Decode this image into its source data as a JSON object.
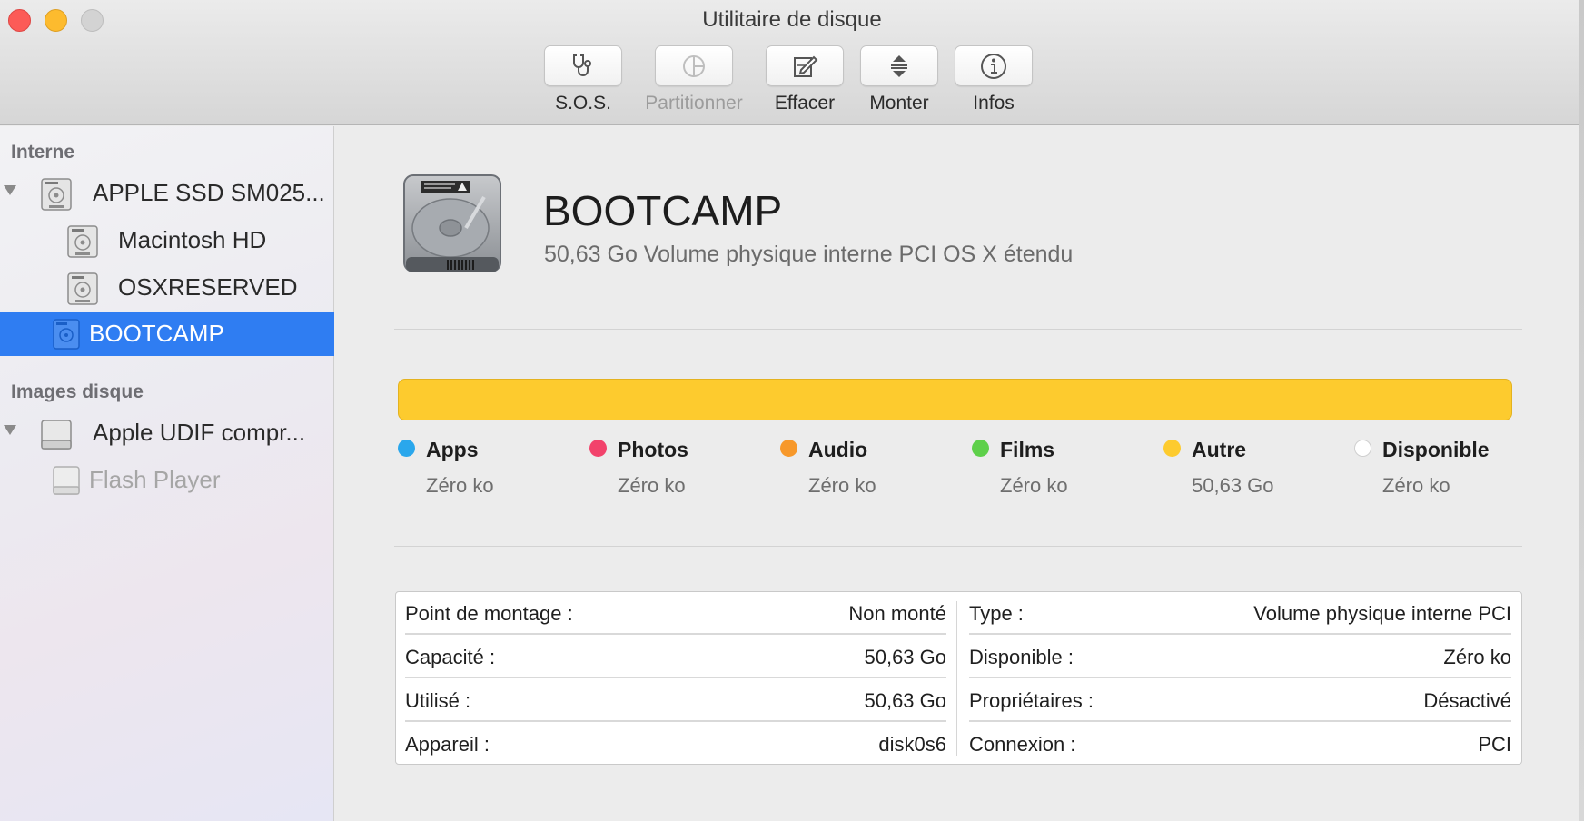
{
  "window": {
    "title": "Utilitaire de disque"
  },
  "toolbar": {
    "sos": "S.O.S.",
    "partition": "Partitionner",
    "erase": "Effacer",
    "mount": "Monter",
    "info": "Infos"
  },
  "sidebar": {
    "internal_header": "Interne",
    "images_header": "Images disque",
    "items": [
      {
        "label": "APPLE SSD SM025...",
        "icon": "hard-drive-icon"
      },
      {
        "label": "Macintosh HD",
        "icon": "hard-drive-icon"
      },
      {
        "label": "OSXRESERVED",
        "icon": "hard-drive-icon"
      },
      {
        "label": "BOOTCAMP",
        "icon": "hard-drive-icon",
        "selected": true
      },
      {
        "label": "Apple UDIF compr...",
        "icon": "disk-image-icon"
      },
      {
        "label": "Flash Player",
        "icon": "disk-image-icon"
      }
    ]
  },
  "volume": {
    "name": "BOOTCAMP",
    "description": "50,63 Go Volume physique interne PCI OS X étendu"
  },
  "usage": {
    "bar_color": "#fdcb2e",
    "categories": [
      {
        "name": "Apps",
        "value": "Zéro ko",
        "color": "#2aa7ec"
      },
      {
        "name": "Photos",
        "value": "Zéro ko",
        "color": "#f2426b"
      },
      {
        "name": "Audio",
        "value": "Zéro ko",
        "color": "#f7982a"
      },
      {
        "name": "Films",
        "value": "Zéro ko",
        "color": "#5ed04a"
      },
      {
        "name": "Autre",
        "value": "50,63 Go",
        "color": "#fdcb2e"
      },
      {
        "name": "Disponible",
        "value": "Zéro ko",
        "color": "#ffffff"
      }
    ]
  },
  "info": {
    "left": [
      {
        "key": "Point de montage :",
        "value": "Non monté"
      },
      {
        "key": "Capacité :",
        "value": "50,63 Go"
      },
      {
        "key": "Utilisé :",
        "value": "50,63 Go"
      },
      {
        "key": "Appareil :",
        "value": "disk0s6"
      }
    ],
    "right": [
      {
        "key": "Type :",
        "value": "Volume physique interne PCI"
      },
      {
        "key": "Disponible :",
        "value": "Zéro ko"
      },
      {
        "key": "Propriétaires :",
        "value": "Désactivé"
      },
      {
        "key": "Connexion :",
        "value": "PCI"
      }
    ]
  }
}
